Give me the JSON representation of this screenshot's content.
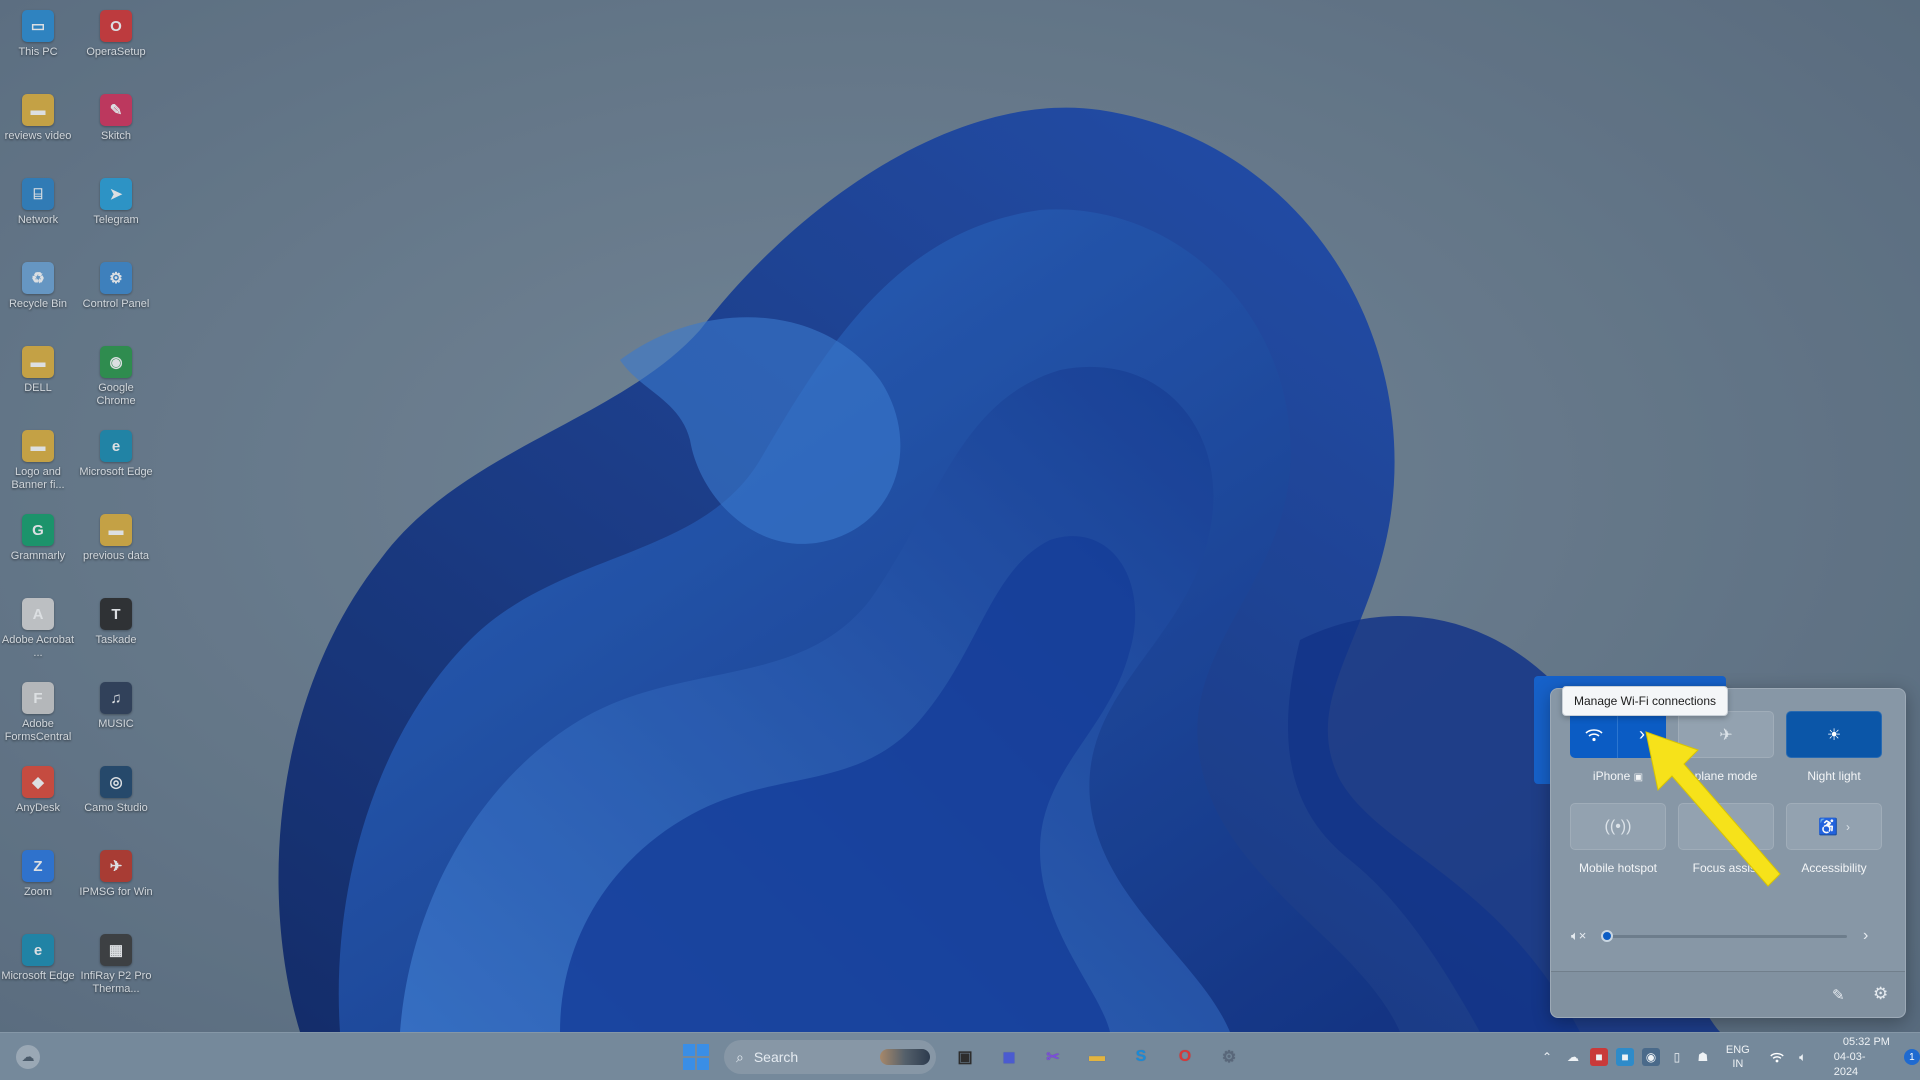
{
  "desktop": {
    "icons": [
      {
        "label": "This PC",
        "icon": "monitor-icon",
        "color": "#2c8fd6",
        "glyph": "▭"
      },
      {
        "label": "OperaSetup",
        "icon": "opera-icon",
        "color": "#d93838",
        "glyph": "O"
      },
      {
        "label": "reviews video",
        "icon": "folder-icon",
        "color": "#e2b440",
        "glyph": "▬"
      },
      {
        "label": "Skitch",
        "icon": "skitch-icon",
        "color": "#d8345f",
        "glyph": "✎"
      },
      {
        "label": "Network",
        "icon": "network-icon",
        "color": "#2f86c9",
        "glyph": "⌸"
      },
      {
        "label": "Telegram",
        "icon": "telegram-icon",
        "color": "#2aa3dc",
        "glyph": "➤"
      },
      {
        "label": "Recycle Bin",
        "icon": "recycle-bin-icon",
        "color": "#6fa7d8",
        "glyph": "♻"
      },
      {
        "label": "Control Panel",
        "icon": "control-panel-icon",
        "color": "#3f8bd1",
        "glyph": "⚙"
      },
      {
        "label": "DELL",
        "icon": "folder-icon",
        "color": "#e2b440",
        "glyph": "▬"
      },
      {
        "label": "Google Chrome",
        "icon": "chrome-icon",
        "color": "#2c9a4c",
        "glyph": "◉"
      },
      {
        "label": "Logo and Banner fi...",
        "icon": "folder-icon",
        "color": "#e2b440",
        "glyph": "▬"
      },
      {
        "label": "Microsoft Edge",
        "icon": "edge-icon",
        "color": "#1b8fb5",
        "glyph": "e"
      },
      {
        "label": "Grammarly",
        "icon": "grammarly-icon",
        "color": "#15a36e",
        "glyph": "G"
      },
      {
        "label": "previous data",
        "icon": "folder-icon",
        "color": "#e2b440",
        "glyph": "▬"
      },
      {
        "label": "Adobe Acrobat ...",
        "icon": "acrobat-icon",
        "color": "#d8d8d8",
        "glyph": "A"
      },
      {
        "label": "Taskade",
        "icon": "taskade-icon",
        "color": "#2d2d2d",
        "glyph": "T"
      },
      {
        "label": "Adobe FormsCentral",
        "icon": "forms-central-icon",
        "color": "#cfcfcf",
        "glyph": "F"
      },
      {
        "label": "MUSIC",
        "icon": "music-folder-icon",
        "color": "#2f3f5a",
        "glyph": "♫"
      },
      {
        "label": "AnyDesk",
        "icon": "anydesk-icon",
        "color": "#e34b3a",
        "glyph": "◆"
      },
      {
        "label": "Camo Studio",
        "icon": "camo-icon",
        "color": "#21486e",
        "glyph": "◎"
      },
      {
        "label": "Zoom",
        "icon": "zoom-icon",
        "color": "#2c7be5",
        "glyph": "Z"
      },
      {
        "label": "IPMSG for Win",
        "icon": "ipmsg-icon",
        "color": "#c0392b",
        "glyph": "✈"
      },
      {
        "label": "Microsoft Edge",
        "icon": "edge-icon",
        "color": "#1b8fb5",
        "glyph": "e"
      },
      {
        "label": "InfiRay P2 Pro Therma...",
        "icon": "infiray-icon",
        "color": "#3d3d3d",
        "glyph": "▦"
      }
    ]
  },
  "tooltip": {
    "text": "Manage Wi-Fi connections"
  },
  "quick_settings": {
    "tiles": [
      {
        "label": "iPhone",
        "icon": "wifi-icon",
        "active": true,
        "split": true
      },
      {
        "label": "plane mode",
        "icon": "airplane-icon",
        "active": false
      },
      {
        "label": "Night light",
        "icon": "brightness-icon",
        "active": true
      },
      {
        "label": "Mobile hotspot",
        "icon": "hotspot-icon",
        "active": false
      },
      {
        "label": "Focus assist",
        "icon": "moon-icon",
        "active": false
      },
      {
        "label": "Accessibility",
        "icon": "accessibility-icon",
        "active": false
      }
    ],
    "volume": {
      "level": 0,
      "mute_icon": "speaker-mute-icon"
    },
    "colors": {
      "accent": "#0b5cc4",
      "panel": "#8797a6"
    }
  },
  "taskbar": {
    "search_placeholder": "Search",
    "apps": [
      {
        "name": "task-view",
        "glyph": "▣",
        "color": "#2d2d2d"
      },
      {
        "name": "chat",
        "glyph": "◼",
        "color": "#4b5bd0"
      },
      {
        "name": "snipping",
        "glyph": "✂",
        "color": "#7b4ed8"
      },
      {
        "name": "file-explorer",
        "glyph": "▬",
        "color": "#e2b440"
      },
      {
        "name": "skype",
        "glyph": "S",
        "color": "#1a8ad8"
      },
      {
        "name": "opera",
        "glyph": "O",
        "color": "#d93838"
      },
      {
        "name": "settings",
        "glyph": "⚙",
        "color": "#59677a"
      }
    ],
    "tray": {
      "lang_top": "ENG",
      "lang_bottom": "IN",
      "time": "05:32 PM",
      "date": "04-03-2024",
      "notifications": "1"
    }
  }
}
